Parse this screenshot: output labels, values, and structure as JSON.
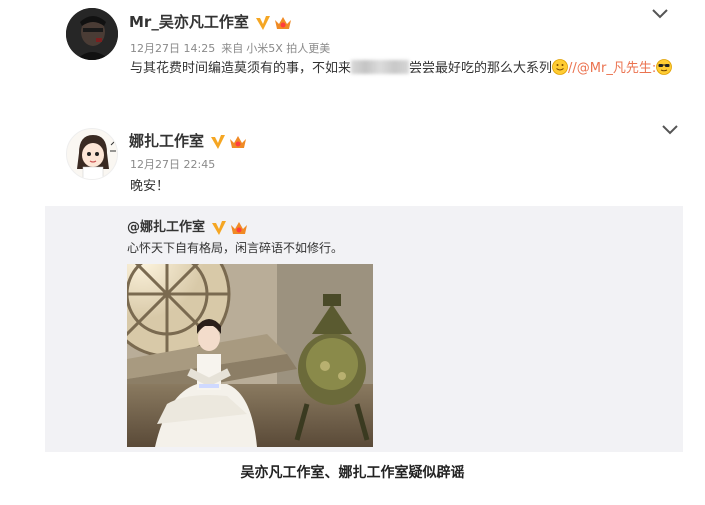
{
  "post1": {
    "author": "Mr_吴亦凡工作室",
    "time": "12月27日 14:25",
    "from_label": "来自",
    "device": "小米5X 拍人更美",
    "text_before": "与其花费时间编造莫须有的事，不如来",
    "text_after": "尝尝最好吃的那么大系列",
    "mention": "//@Mr_凡先生:"
  },
  "post2": {
    "author": "娜扎工作室",
    "time": "12月27日 22:45",
    "text": "晚安！",
    "repost": {
      "author": "@娜扎工作室",
      "text": "心怀天下自有格局，闲言碎语不如修行。"
    }
  },
  "caption": "吴亦凡工作室、娜扎工作室疑似辟谣",
  "icons": {
    "verified": "verified-v-icon",
    "crown": "vip-crown-icon",
    "chevron": "chevron-down-icon",
    "smile": "smile-emoji-icon",
    "cool": "cool-emoji-icon"
  },
  "colors": {
    "verified": "#f5a623",
    "mention": "#eb7350",
    "repost_bg": "#f2f2f5",
    "meta": "#8a8a8a"
  }
}
